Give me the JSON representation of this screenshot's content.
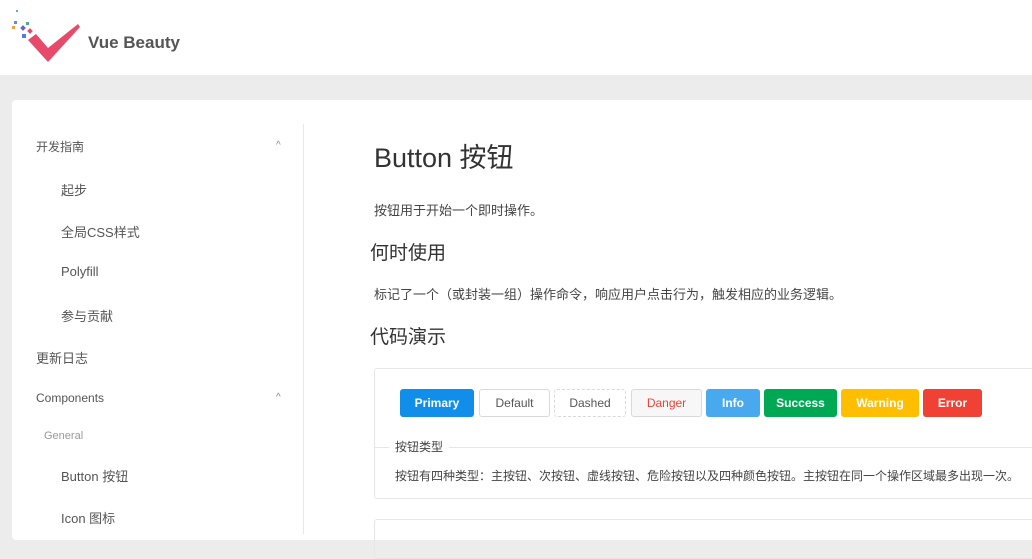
{
  "header": {
    "brand": "Vue Beauty"
  },
  "sidebar": {
    "items": [
      {
        "label": "开发指南"
      },
      {
        "label": "起步"
      },
      {
        "label": "全局CSS样式"
      },
      {
        "label": "Polyfill"
      },
      {
        "label": "参与贡献"
      },
      {
        "label": "更新日志"
      },
      {
        "label": "Components"
      },
      {
        "label": "General"
      },
      {
        "label": "Button 按钮"
      },
      {
        "label": "Icon 图标"
      }
    ],
    "chevron": "^"
  },
  "main": {
    "title": "Button 按钮",
    "intro": "按钮用于开始一个即时操作。",
    "when_heading": "何时使用",
    "when_text": "标记了一个（或封装一组）操作命令，响应用户点击行为，触发相应的业务逻辑。",
    "demo_heading": "代码演示",
    "demo": {
      "buttons": [
        {
          "label": "Primary",
          "color": "#108ee9"
        },
        {
          "label": "Default"
        },
        {
          "label": "Dashed"
        },
        {
          "label": "Danger",
          "color": "#f04134"
        },
        {
          "label": "Info",
          "color": "#49a9ee"
        },
        {
          "label": "Success",
          "color": "#00a854"
        },
        {
          "label": "Warning",
          "color": "#ffbf00"
        },
        {
          "label": "Error",
          "color": "#f04134"
        }
      ],
      "legend": "按钮类型",
      "description": "按钮有四种类型：主按钮、次按钮、虚线按钮、危险按钮以及四种颜色按钮。主按钮在同一个操作区域最多出现一次。"
    }
  }
}
